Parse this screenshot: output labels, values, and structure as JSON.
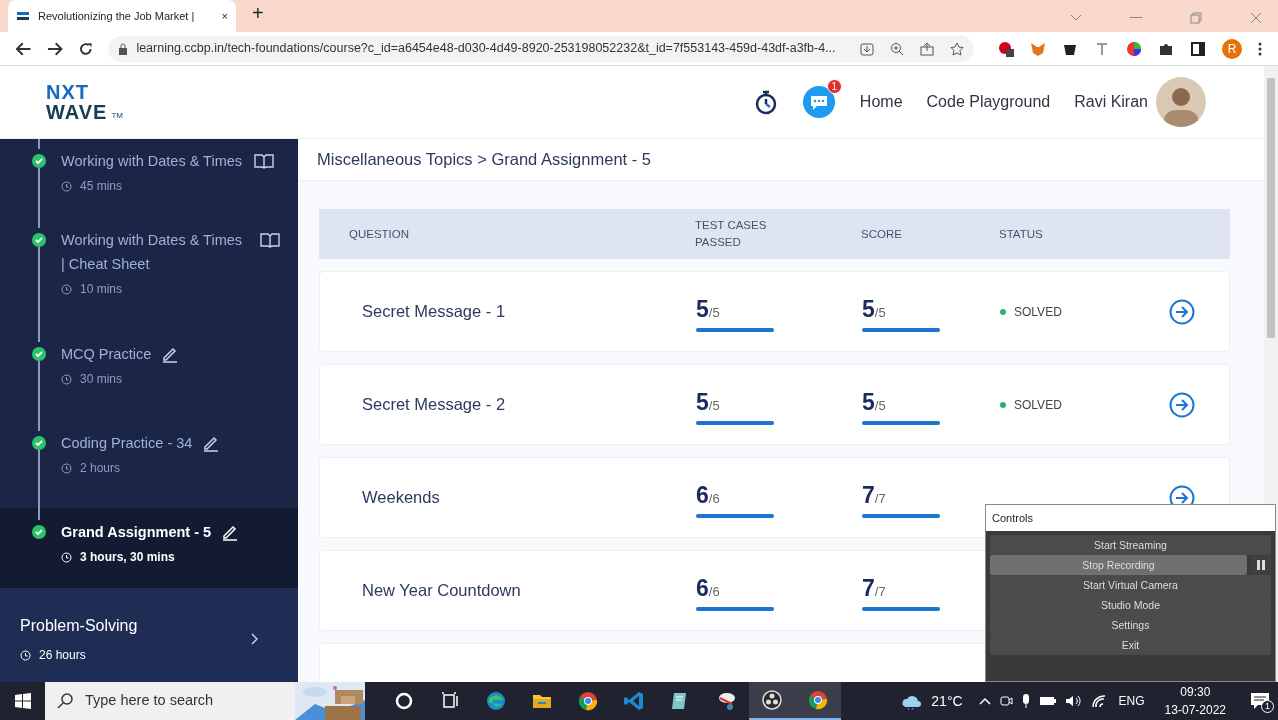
{
  "browser": {
    "tab": {
      "title": "Revolutionizing the Job Market |",
      "close": "×"
    },
    "new_tab": "+",
    "address": "learning.ccbp.in/tech-foundations/course?c_id=a6454e48-d030-4d49-8920-253198052232&t_id=7f553143-459d-43df-a3fb-4...",
    "profile_initial": "R"
  },
  "header": {
    "logo": {
      "line_1": "NXT",
      "line_2": "WAVE",
      "mark": "TM"
    },
    "notification_count": "1",
    "nav": [
      "Home",
      "Code Playground"
    ],
    "user": "Ravi Kiran"
  },
  "sidebar": {
    "items": [
      {
        "title": "Working with Dates & Times",
        "duration": "45 mins",
        "kind": "reading",
        "completed": true,
        "selected": false
      },
      {
        "title": "Working with Dates & Times | Cheat Sheet",
        "duration": "10 mins",
        "kind": "reading",
        "completed": true,
        "selected": false
      },
      {
        "title": "MCQ Practice",
        "duration": "30 mins",
        "kind": "practice",
        "completed": true,
        "selected": false
      },
      {
        "title": "Coding Practice - 34",
        "duration": "2 hours",
        "kind": "practice",
        "completed": true,
        "selected": false
      },
      {
        "title": "Grand Assignment - 5",
        "duration": "3 hours, 30 mins",
        "kind": "practice",
        "completed": true,
        "selected": true
      }
    ],
    "section": {
      "title": "Problem-Solving",
      "duration": "26 hours"
    }
  },
  "breadcrumb": "Miscellaneous Topics > Grand Assignment - 5",
  "table": {
    "columns": [
      "QUESTION",
      "TEST CASES PASSED",
      "SCORE",
      "STATUS"
    ],
    "rows": [
      {
        "question": "Secret Message - 1",
        "test_cases": {
          "value": "5",
          "total": "/5",
          "level": 1
        },
        "score": {
          "value": "5",
          "total": "/5",
          "level": 1
        },
        "status": "SOLVED",
        "open_arrow": true
      },
      {
        "question": "Secret Message - 2",
        "test_cases": {
          "value": "5",
          "total": "/5",
          "level": 1
        },
        "score": {
          "value": "5",
          "total": "/5",
          "level": 1
        },
        "status": "SOLVED",
        "open_arrow": true
      },
      {
        "question": "Weekends",
        "test_cases": {
          "value": "6",
          "total": "/6",
          "level": 1
        },
        "score": {
          "value": "7",
          "total": "/7",
          "level": 1
        },
        "open_arrow": true
      },
      {
        "question": "New Year Countdown",
        "test_cases": {
          "value": "6",
          "total": "/6",
          "level": 1
        },
        "score": {
          "value": "7",
          "total": "/7",
          "level": 1
        }
      }
    ]
  },
  "obs_controls": {
    "title": "Controls",
    "buttons": [
      {
        "label": "Start Streaming",
        "highlighted": false
      },
      {
        "label": "Stop Recording",
        "highlighted": true,
        "pause": true
      },
      {
        "label": "Start Virtual Camera",
        "highlighted": false
      },
      {
        "label": "Studio Mode",
        "highlighted": false
      },
      {
        "label": "Settings",
        "highlighted": false
      },
      {
        "label": "Exit",
        "highlighted": false
      }
    ]
  },
  "taskbar": {
    "search_placeholder": "Type here to search",
    "apps": [
      {
        "kind": "cortana",
        "active": false
      },
      {
        "kind": "taskview",
        "active": false
      },
      {
        "kind": "edge",
        "active": false
      },
      {
        "kind": "explorer",
        "active": false
      },
      {
        "kind": "chrome",
        "active": false
      },
      {
        "kind": "vscode",
        "active": false
      },
      {
        "kind": "notepad",
        "active": false
      },
      {
        "kind": "snip",
        "active": false
      },
      {
        "kind": "obs",
        "active": true
      },
      {
        "kind": "chrome",
        "active": true
      }
    ],
    "weather": "21°C",
    "language": "ENG",
    "time": "09:30",
    "date": "13-07-2022",
    "notifications": "1"
  }
}
